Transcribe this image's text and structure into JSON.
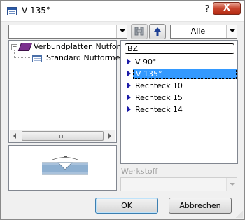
{
  "window": {
    "title": "V 135°"
  },
  "titlebar": {
    "help_label": "?",
    "close_label": "X"
  },
  "toolbar": {
    "path_value": "",
    "filter_value": "Alle"
  },
  "tree": {
    "items": [
      {
        "label": "Verbundplatten Nutform"
      },
      {
        "label": "Standard Nutformen"
      }
    ]
  },
  "list": {
    "filter_text": "BZ",
    "items": [
      {
        "label": "V 90°"
      },
      {
        "label": "V 135°"
      },
      {
        "label": "Rechteck 10"
      },
      {
        "label": "Rechteck 15"
      },
      {
        "label": "Rechteck 14"
      }
    ],
    "selected_index": 1
  },
  "werkstoff": {
    "label": "Werkstoff",
    "value": ""
  },
  "buttons": {
    "ok_label": "OK",
    "cancel_label": "Abbrechen"
  },
  "colors": {
    "selection": "#3399ff",
    "list_arrow": "#1a1aa8",
    "close_button": "#c7442d"
  }
}
